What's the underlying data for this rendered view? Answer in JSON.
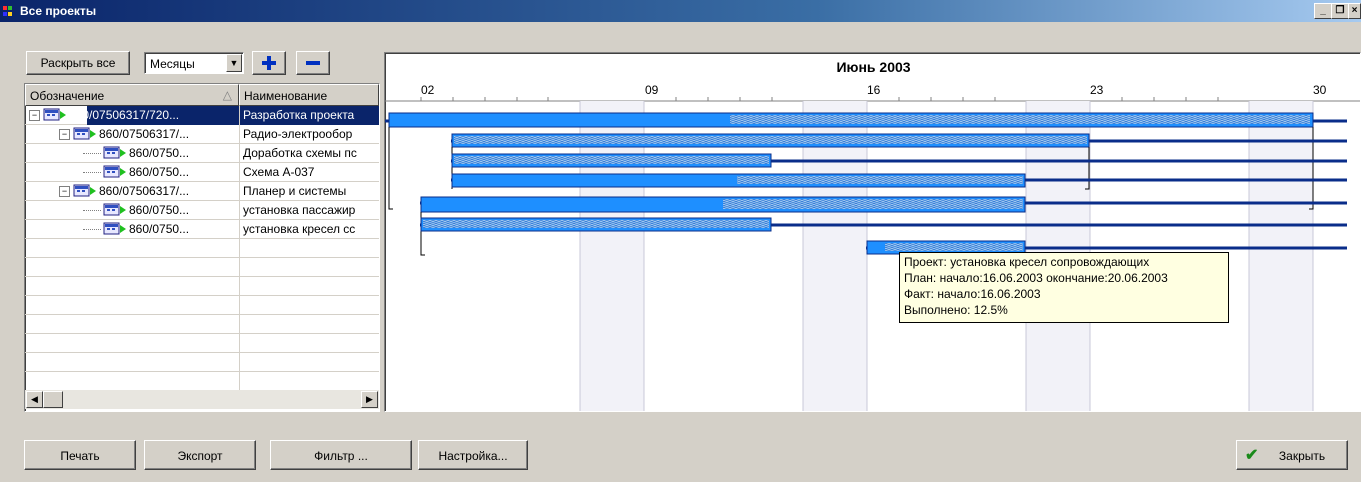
{
  "window": {
    "title": "Все проекты"
  },
  "toolbar": {
    "expand_all_label": "Раскрыть все",
    "scale_value": "Месяцы",
    "zoom_in_label": "+",
    "zoom_out_label": "−"
  },
  "grid": {
    "columns": [
      "Обозначение",
      "Наименование"
    ],
    "rows": [
      {
        "code": "860/07506317/720...",
        "name": "Разработка проекта"
      },
      {
        "code": "860/07506317/...",
        "name": "Радио-электрообор"
      },
      {
        "code": "860/0750...",
        "name": "Доработка схемы пс"
      },
      {
        "code": "860/0750...",
        "name": "Схема А-037"
      },
      {
        "code": "860/07506317/...",
        "name": "Планер и системы"
      },
      {
        "code": "860/0750...",
        "name": "установка пассажир"
      },
      {
        "code": "860/0750...",
        "name": "установка кресел сс"
      }
    ]
  },
  "gantt": {
    "month_label": "Июнь 2003",
    "day_labels": [
      "02",
      "09",
      "16",
      "23",
      "30"
    ],
    "tooltip": {
      "line1": "Проект: установка кресел сопровождающих",
      "line2": "План: начало:16.06.2003   окончание:20.06.2003",
      "line3": "Факт: начало:16.06.2003",
      "line4": "Выполнено: 12.5%"
    }
  },
  "buttons": {
    "print": "Печать",
    "export": "Экспорт",
    "filter": "Фильтр ...",
    "settings": "Настройка...",
    "close": "Закрыть"
  },
  "colors": {
    "bar_fill": "#1e8fff",
    "bar_plan_line": "#0a2d8a",
    "tooltip_bg": "#ffffe1",
    "titlebar": "#0a246a"
  }
}
